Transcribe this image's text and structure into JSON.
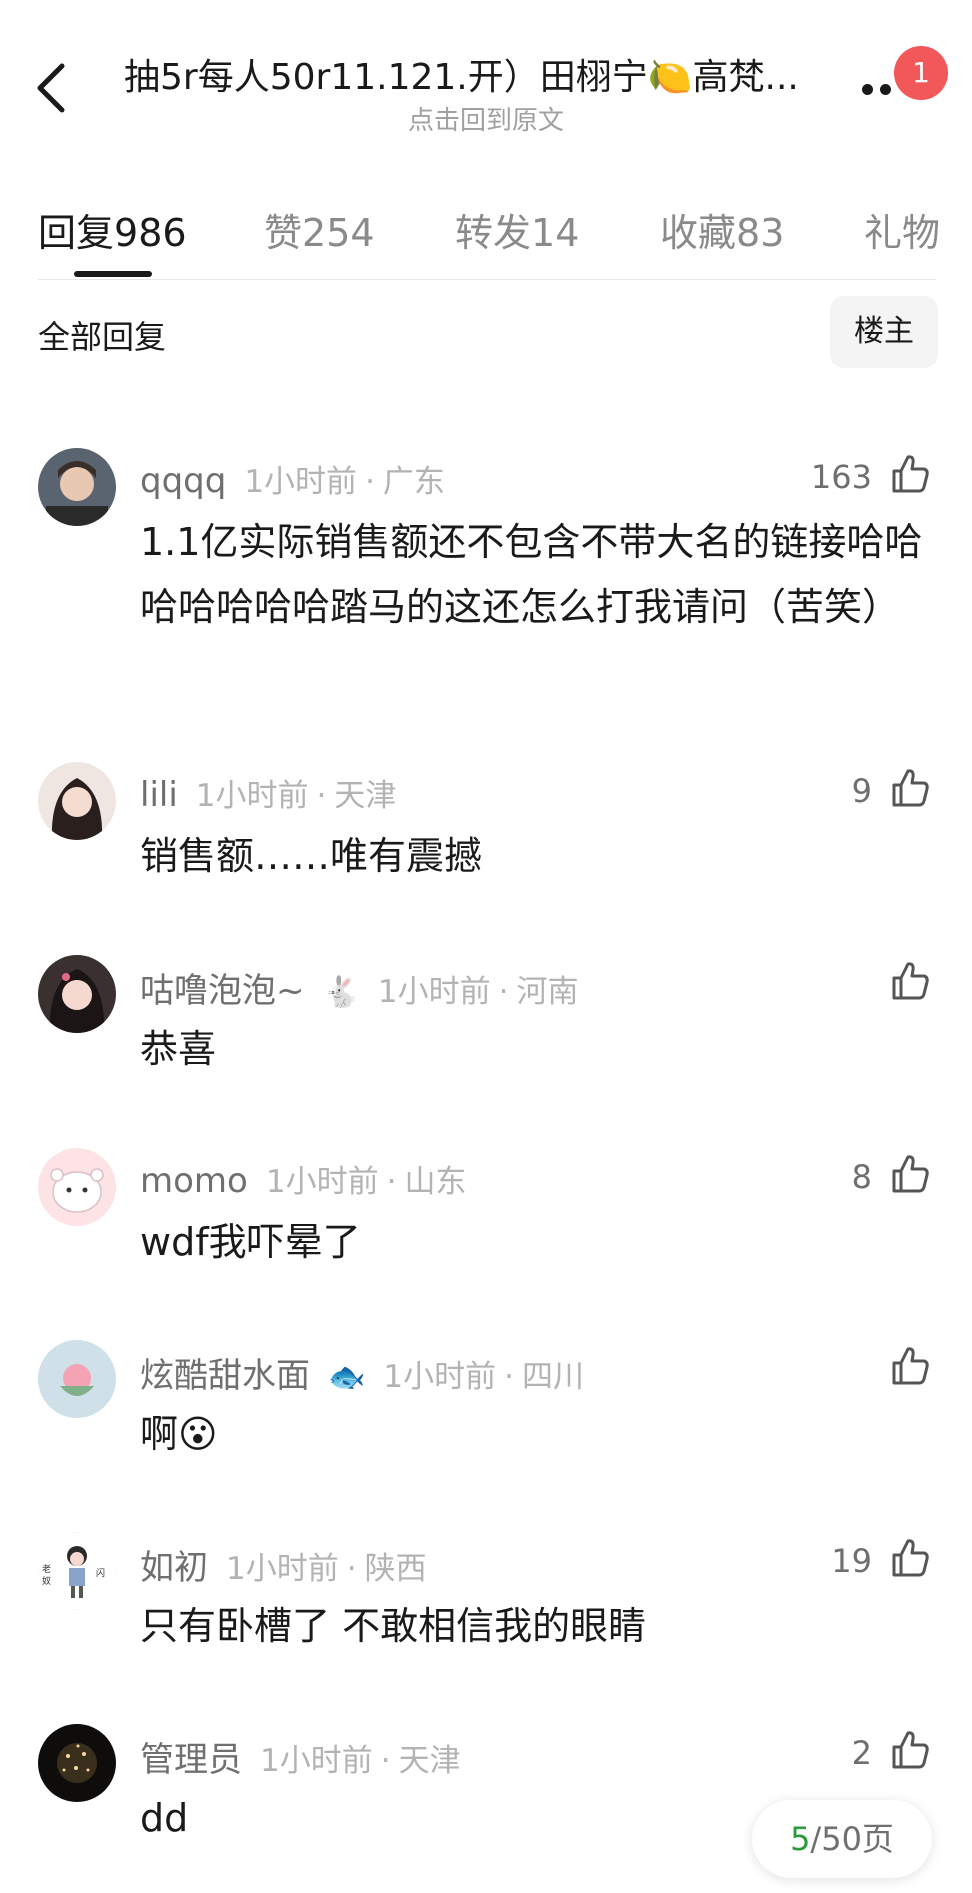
{
  "header": {
    "title": "抽5r每人50r11.121.开）田栩宁🍋高梵...",
    "subtitle": "点击回到原文",
    "badge_count": "1"
  },
  "tabs": [
    {
      "label": "回复",
      "count": "986"
    },
    {
      "label": "赞",
      "count": "254"
    },
    {
      "label": "转发",
      "count": "14"
    },
    {
      "label": "收藏",
      "count": "83"
    },
    {
      "label": "礼物",
      "count": ""
    }
  ],
  "filter": {
    "label": "全部回复",
    "op_button": "楼主"
  },
  "comments": [
    {
      "user": "qqqq",
      "emblem": "",
      "time": "1小时前",
      "location": "广东",
      "likes": "163",
      "text": "1.1亿实际销售额还不包含不带大名的链接哈哈哈哈哈哈哈踏马的这还怎么打我请问（苦笑）"
    },
    {
      "user": "lili",
      "emblem": "",
      "time": "1小时前",
      "location": "天津",
      "likes": "9",
      "text": "销售额……唯有震撼"
    },
    {
      "user": "咕噜泡泡~",
      "emblem": "🐇",
      "time": "1小时前",
      "location": "河南",
      "likes": "",
      "text": "恭喜"
    },
    {
      "user": "momo",
      "emblem": "",
      "time": "1小时前",
      "location": "山东",
      "likes": "8",
      "text": "wdf我吓晕了"
    },
    {
      "user": "炫酷甜水面",
      "emblem": "🐟",
      "time": "1小时前",
      "location": "四川",
      "likes": "",
      "text": "啊😮"
    },
    {
      "user": "如初",
      "emblem": "",
      "time": "1小时前",
      "location": "陕西",
      "likes": "19",
      "text": "只有卧槽了 不敢相信我的眼睛"
    },
    {
      "user": "管理员",
      "emblem": "",
      "time": "1小时前",
      "location": "天津",
      "likes": "2",
      "text": "dd"
    }
  ],
  "pagination": {
    "current": "5",
    "total_label": "/50页"
  },
  "colors": {
    "badge": "#f2575a",
    "page_current": "#2c9a3c"
  }
}
